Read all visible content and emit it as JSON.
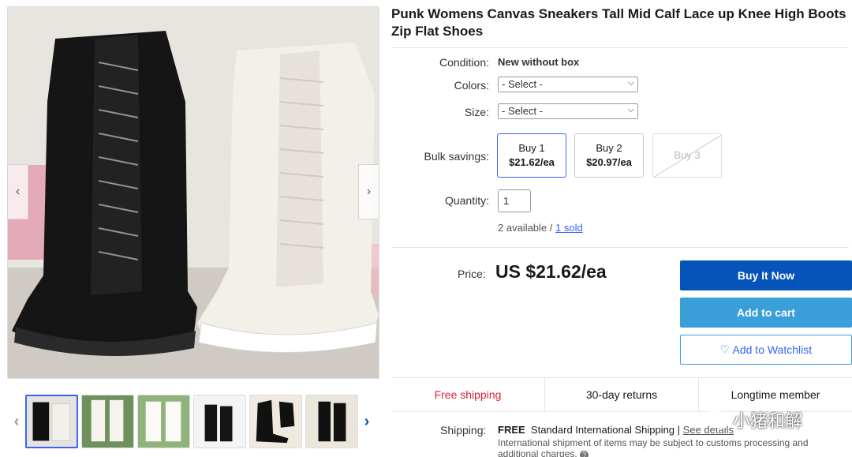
{
  "gallery": {
    "prev_arrow": "‹",
    "next_arrow": "›",
    "thumb_left_arrow": "‹",
    "thumb_right_arrow": "›",
    "thumb_count": 6,
    "selected_thumb": 1
  },
  "product": {
    "title": "Punk Womens Canvas Sneakers Tall Mid Calf Lace up Knee High Boots Zip Flat Shoes"
  },
  "condition": {
    "label": "Condition:",
    "value": "New without box"
  },
  "colors": {
    "label": "Colors:",
    "selected": "- Select -"
  },
  "size": {
    "label": "Size:",
    "selected": "- Select -"
  },
  "bulk": {
    "label": "Bulk savings:",
    "options": [
      {
        "qty": "Buy 1",
        "price": "$21.62/ea"
      },
      {
        "qty": "Buy 2",
        "price": "$20.97/ea"
      },
      {
        "qty": "Buy 3",
        "price": ""
      }
    ]
  },
  "quantity": {
    "label": "Quantity:",
    "value": "1",
    "available": "2 available /",
    "sold": "1 sold"
  },
  "price": {
    "label": "Price:",
    "value": "US $21.62/ea"
  },
  "actions": {
    "buy_now": "Buy It Now",
    "add_to_cart": "Add to cart",
    "watchlist": "Add to Watchlist",
    "heart_icon": "♡"
  },
  "features": [
    "Free shipping",
    "30-day returns",
    "Longtime member"
  ],
  "shipping": {
    "label": "Shipping:",
    "free": "FREE",
    "method": "Standard International Shipping |",
    "details_link": "See details",
    "note": "International shipment of items may be subject to customs processing and additional charges.",
    "info_icon": "?"
  },
  "watermark": {
    "text": "小猪和解"
  },
  "colors_theme": {
    "primary": "#0654ba",
    "secondary": "#3a9ed9",
    "link": "#3665f3",
    "accent_red": "#dd1e31"
  }
}
